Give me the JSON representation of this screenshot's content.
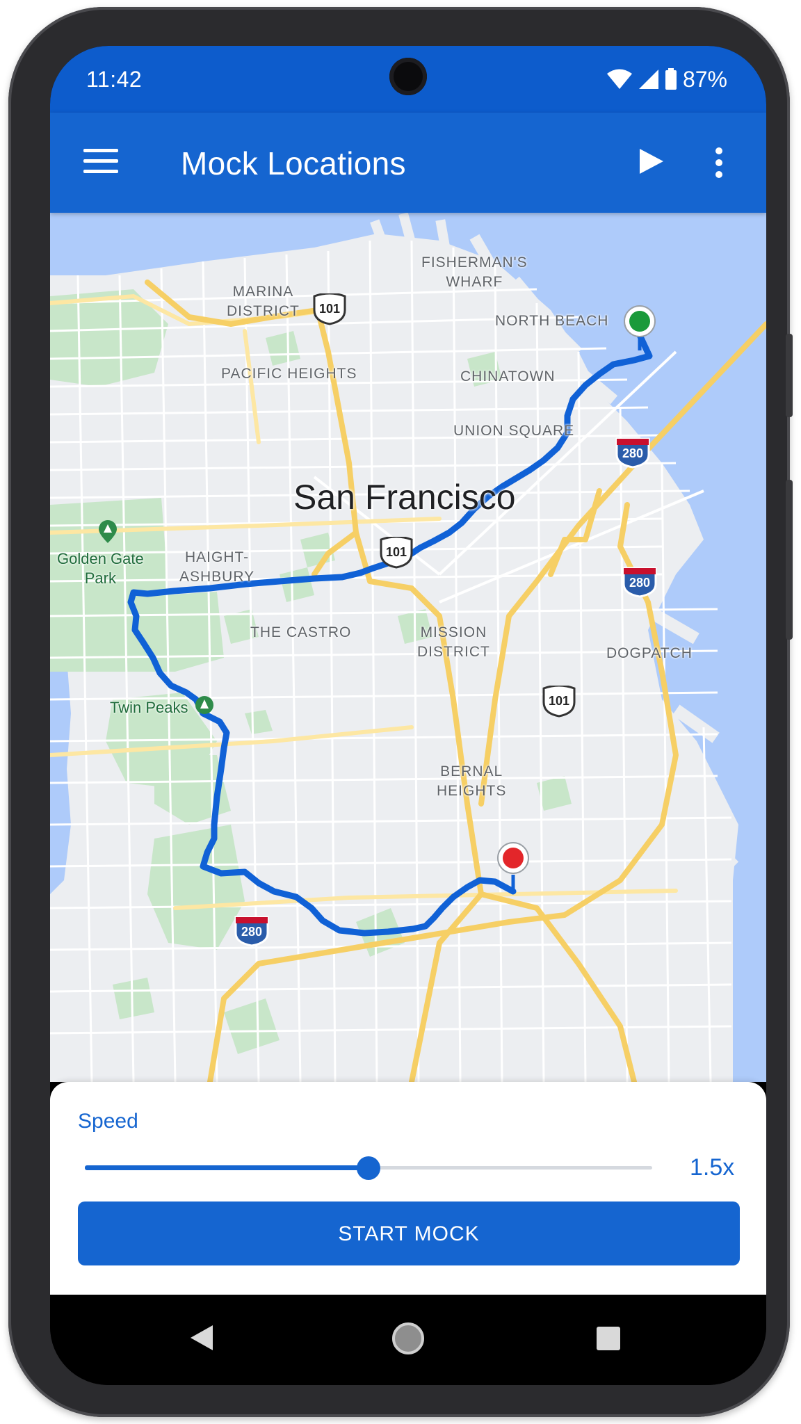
{
  "status_bar": {
    "time": "11:42",
    "battery": "87%",
    "icons": [
      "wifi-icon",
      "cell-signal-icon",
      "battery-icon"
    ]
  },
  "app_bar": {
    "title": "Mock Locations",
    "icons": [
      "menu-icon",
      "play-icon",
      "more-vert-icon"
    ]
  },
  "map": {
    "city": "San Francisco",
    "neighborhoods": {
      "fishermans_wharf": [
        "FISHERMAN'S",
        "WHARF"
      ],
      "marina": [
        "MARINA",
        "DISTRICT"
      ],
      "north_beach": "NORTH BEACH",
      "pacific_heights": "PACIFIC HEIGHTS",
      "chinatown": "CHINATOWN",
      "union_square": "UNION SQUARE",
      "haight_ashbury": [
        "HAIGHT-",
        "ASHBURY"
      ],
      "castro": "THE CASTRO",
      "mission": [
        "MISSION",
        "DISTRICT"
      ],
      "dogpatch": "DOGPATCH",
      "bernal": [
        "BERNAL",
        "HEIGHTS"
      ]
    },
    "parks": {
      "golden_gate": [
        "Golden Gate",
        "Park"
      ],
      "twin_peaks": "Twin Peaks"
    },
    "highways": {
      "us101_north": "101",
      "i280_east": "280",
      "us101_central": "101",
      "i280_bay": "280",
      "us101_south": "101",
      "i280_south": "280"
    },
    "colors": {
      "route": "#1061d6",
      "start_marker": "#1a9a3a",
      "end_marker": "#e3262a",
      "water": "#aecbfa",
      "park": "#c8e6c9",
      "highway": "#f6cf65"
    }
  },
  "panel": {
    "speed_label": "Speed",
    "speed_value": "1.5x",
    "speed_fraction": 0.5,
    "start_button": "START MOCK"
  },
  "nav_bar": {
    "icons": [
      "back-icon",
      "home-icon",
      "recents-icon"
    ]
  }
}
